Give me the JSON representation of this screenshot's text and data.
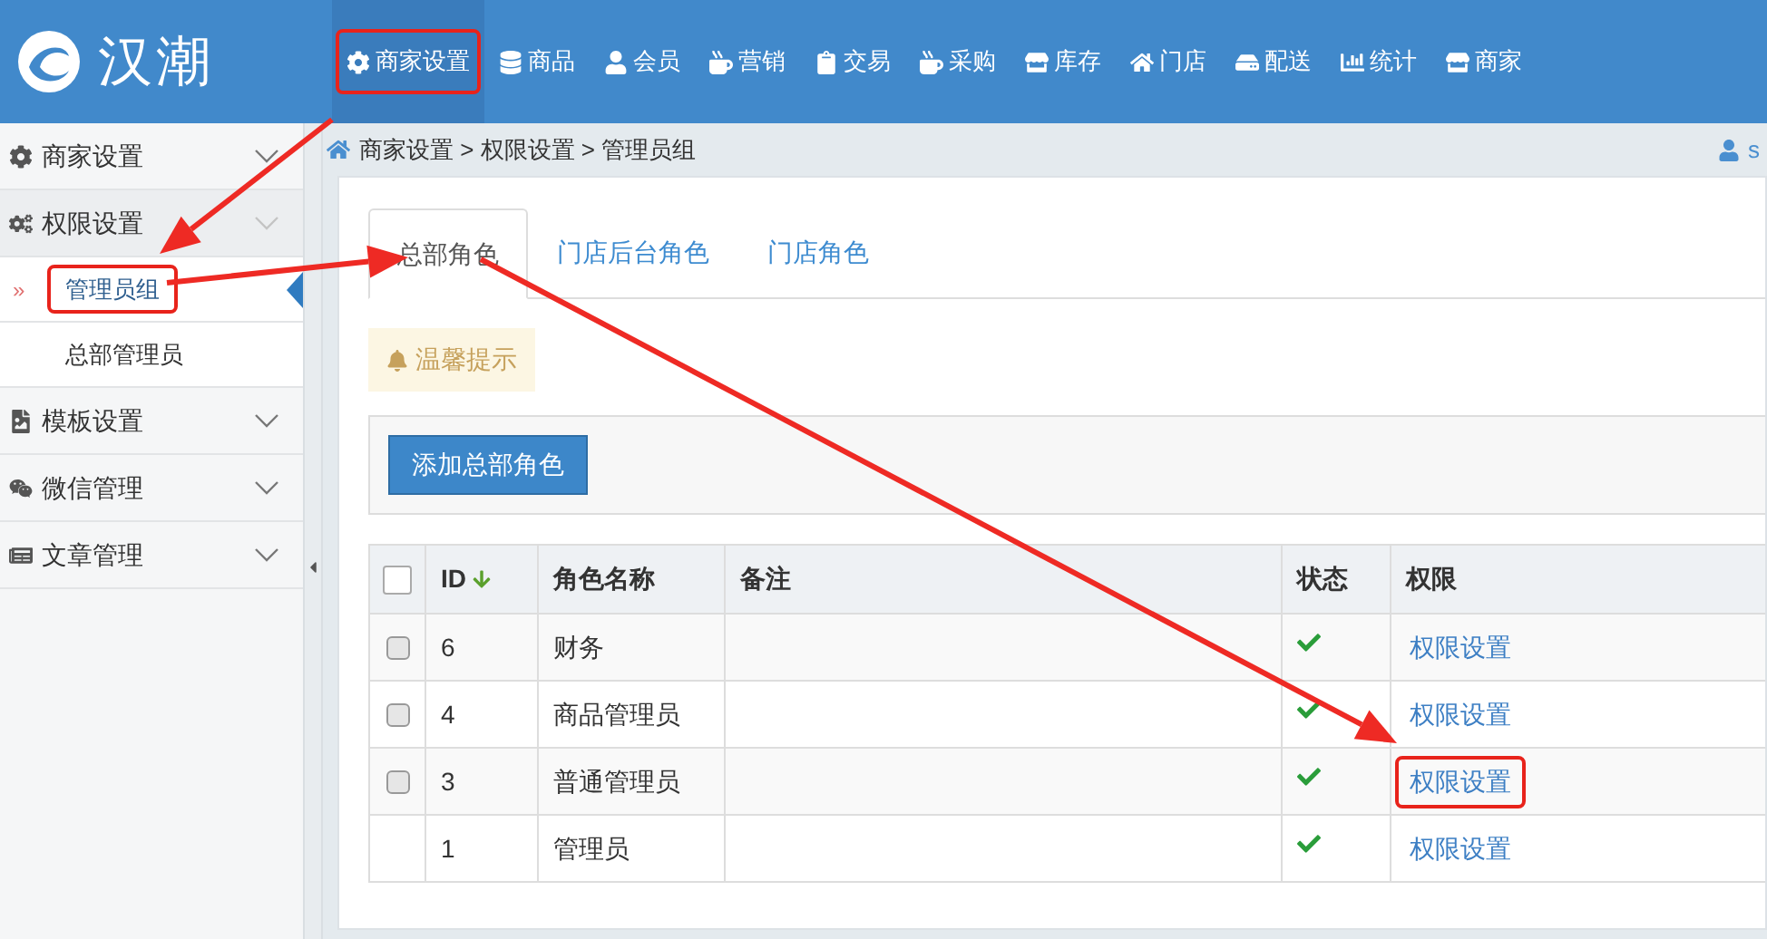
{
  "logo": {
    "text": "汉潮"
  },
  "nav": [
    {
      "label": "商家设置",
      "selected": true,
      "highlighted": true
    },
    {
      "label": "商品",
      "selected": false,
      "highlighted": false
    },
    {
      "label": "会员",
      "selected": false,
      "highlighted": false
    },
    {
      "label": "营销",
      "selected": false,
      "highlighted": false
    },
    {
      "label": "交易",
      "selected": false,
      "highlighted": false
    },
    {
      "label": "采购",
      "selected": false,
      "highlighted": false
    },
    {
      "label": "库存",
      "selected": false,
      "highlighted": false
    },
    {
      "label": "门店",
      "selected": false,
      "highlighted": false
    },
    {
      "label": "配送",
      "selected": false,
      "highlighted": false
    },
    {
      "label": "统计",
      "selected": false,
      "highlighted": false
    },
    {
      "label": "商家",
      "selected": false,
      "highlighted": false
    }
  ],
  "sidebar": [
    {
      "label": "商家设置",
      "expanded": false
    },
    {
      "label": "权限设置",
      "expanded": true,
      "children": [
        {
          "label": "管理员组",
          "marker": "»",
          "selected": true,
          "highlighted": true
        },
        {
          "label": "总部管理员",
          "selected": false,
          "highlighted": false
        }
      ]
    },
    {
      "label": "模板设置",
      "expanded": false
    },
    {
      "label": "微信管理",
      "expanded": false
    },
    {
      "label": "文章管理",
      "expanded": false
    }
  ],
  "breadcrumb": "商家设置 > 权限设置 > 管理员组",
  "user": "s",
  "tabs": [
    {
      "label": "总部角色",
      "selected": true
    },
    {
      "label": "门店后台角色",
      "selected": false
    },
    {
      "label": "门店角色",
      "selected": false
    }
  ],
  "notice": "温馨提示",
  "add_button": "添加总部角色",
  "table": {
    "select_all_checked": false,
    "columns": [
      {
        "label": "ID",
        "sorted": true
      },
      {
        "label": "角色名称",
        "sorted": false
      },
      {
        "label": "备注",
        "sorted": false
      },
      {
        "label": "状态",
        "sorted": false
      },
      {
        "label": "权限",
        "sorted": false
      }
    ],
    "rows": [
      {
        "id": "6",
        "name": "财务",
        "has_checkbox": true,
        "checked": false,
        "active": true,
        "link": "权限设置",
        "highlighted": false
      },
      {
        "id": "4",
        "name": "商品管理员",
        "has_checkbox": true,
        "checked": false,
        "active": true,
        "link": "权限设置",
        "highlighted": false
      },
      {
        "id": "3",
        "name": "普通管理员",
        "has_checkbox": true,
        "checked": false,
        "active": true,
        "link": "权限设置",
        "highlighted": true
      },
      {
        "id": "1",
        "name": "管理员",
        "has_checkbox": false,
        "active": true,
        "link": "权限设置",
        "highlighted": false
      }
    ]
  }
}
